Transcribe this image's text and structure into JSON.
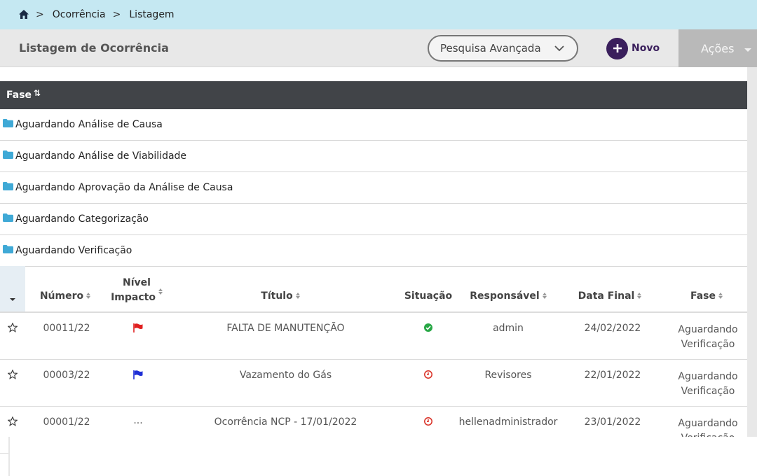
{
  "breadcrumb": {
    "sep": ">",
    "items": [
      "Ocorrência",
      "Listagem"
    ]
  },
  "header": {
    "title": "Listagem de Ocorrência",
    "advanced_search": "Pesquisa Avançada",
    "new_button": "Novo",
    "actions_button": "Ações"
  },
  "grouping": {
    "column": "Fase",
    "sort_glyph": "⇅",
    "groups": [
      "Aguardando Análise de Causa",
      "Aguardando Análise de Viabilidade",
      "Aguardando Aprovação da Análise de Causa",
      "Aguardando Categorização",
      "Aguardando Verificação"
    ]
  },
  "table": {
    "columns": {
      "numero": "Número",
      "nivel_1": "Nível",
      "nivel_2": "Impacto",
      "titulo": "Título",
      "situacao": "Situação",
      "responsavel": "Responsável",
      "data_final": "Data Final",
      "fase": "Fase"
    },
    "rows": [
      {
        "numero": "00011/22",
        "impact": "flag-red",
        "impact_color": "#e02020",
        "titulo": "FALTA DE MANUTENÇÃO",
        "status": "check-circle-icon",
        "status_color": "#27a745",
        "responsavel": "admin",
        "data_final": "24/02/2022",
        "fase_1": "Aguardando",
        "fase_2": "Verificação"
      },
      {
        "numero": "00003/22",
        "impact": "flag-blue",
        "impact_color": "#1f2fd6",
        "titulo": "Vazamento do Gás",
        "status": "clock-icon",
        "status_color": "#d93025",
        "responsavel": "Revisores",
        "data_final": "22/01/2022",
        "fase_1": "Aguardando",
        "fase_2": "Verificação"
      },
      {
        "numero": "00001/22",
        "impact_text": "...",
        "titulo": "Ocorrência NCP - 17/01/2022",
        "status": "clock-icon",
        "status_color": "#d93025",
        "responsavel": "hellenadministrador",
        "data_final": "23/01/2022",
        "fase_1": "Aguardando",
        "fase_2": "Verificação"
      }
    ]
  }
}
